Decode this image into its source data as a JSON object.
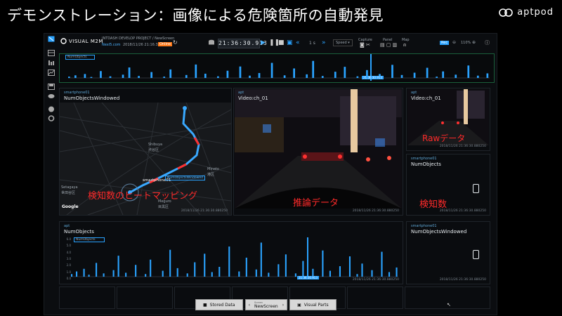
{
  "slide": {
    "title": "デモンストレーション：画像による危険箇所の自動発見",
    "logo_text": "aptpod"
  },
  "app": {
    "brand": "VISUAL M2M",
    "project": "INTDASH DEVELOP PROJECT / NewScreen",
    "edge": "Nexi5.com",
    "date": "2018/11/26 21:16:37 ~",
    "live_badge": "Online",
    "clock": "21:36:30.913",
    "rate": "1 s",
    "speed_label": "Speed",
    "capture_label": "Capture",
    "panel_label": "Panel",
    "map_label": "Map",
    "mode_badge": "Rec",
    "zoom": "110%",
    "timeline_legend": "NumObjects",
    "timeline_marker": "21:36:30.913"
  },
  "colors": {
    "accent": "#2aa3ff",
    "timeline_border": "#1a5e3a",
    "route": "#39a9ff",
    "route_hot": "#ff2f2f",
    "annotation": "#ff2a2a"
  },
  "panels": {
    "map": {
      "tag": "smartphone01",
      "title": "NumObjectsWindowed",
      "device_label": "smartphone01",
      "chip_label": "NumObjectsWindowed",
      "places": [
        "Shibuya",
        "渋谷区",
        "Minato",
        "港区",
        "Setagaya",
        "世田谷区",
        "Meguro",
        "目黒区"
      ],
      "google": "Google",
      "footer": "2018/11/26 21:36:30.880250",
      "annotation": "検知数のヒートマッピング"
    },
    "video1": {
      "tag": "apt",
      "title": "Video:ch_01",
      "footer": "2018/11/26 21:36:30.880250",
      "annotation": "推論データ"
    },
    "video2": {
      "tag": "apt",
      "title": "Video:ch_01",
      "footer": "2018/11/26 21:36:30.880250",
      "annotation": "Rawデータ"
    },
    "count1": {
      "tag": "smartphone01",
      "title": "NumObjects",
      "footer": "2018/11/26 21:36:30.880250",
      "annotation": "検知数"
    },
    "chart": {
      "tag": "apt",
      "title": "NumObjects",
      "legend": "NumObjects",
      "marker": "21:36:30.913",
      "footer": "2018/11/26 21:36:30.880250",
      "yticks": [
        "6.0",
        "5.0",
        "4.0",
        "3.0",
        "2.0",
        "1.0",
        "0.0"
      ]
    },
    "count2": {
      "tag": "smartphone01",
      "title": "NumObjectsWindowed",
      "footer": "2018/11/26 21:36:30.880250"
    }
  },
  "bottom": {
    "stored": "Stored Data",
    "screen_small": "Screen",
    "screen": "NewScreen",
    "visual": "Visual Parts"
  },
  "chart_data": {
    "type": "bar",
    "title": "NumObjects",
    "ylim": [
      0,
      6
    ],
    "yticks": [
      "6.0",
      "5.0",
      "4.0",
      "3.0",
      "2.0",
      "1.0",
      "0.0"
    ],
    "values": [
      0.4,
      0,
      0.8,
      0,
      0,
      1.2,
      0,
      0.3,
      0,
      0,
      2.1,
      0,
      0,
      0.5,
      0,
      0,
      0,
      1.0,
      0,
      3.2,
      0,
      0,
      0.6,
      0,
      0,
      0,
      1.8,
      0,
      0,
      0,
      0.4,
      0,
      2.6,
      0,
      0,
      0,
      0,
      0.9,
      0,
      0,
      4.1,
      0,
      0,
      1.3,
      0,
      0,
      0,
      0.5,
      0,
      0,
      2.2,
      0,
      0,
      0,
      3.5,
      0,
      0,
      0.7,
      0,
      0,
      1.5,
      0,
      0,
      0,
      4.6,
      0,
      0,
      0,
      0.8,
      0,
      0,
      2.9,
      0,
      0,
      0,
      1.1,
      0,
      5.2,
      0,
      0,
      0.6,
      0,
      0,
      0,
      1.9,
      0,
      0,
      3.4,
      0,
      0,
      0,
      0.5,
      0,
      0,
      2.4,
      0,
      0,
      0,
      1.2,
      0,
      0,
      0,
      4.0,
      0,
      0,
      0.9,
      0,
      0,
      0,
      1.6,
      0,
      0,
      0,
      3.1,
      0,
      0,
      0.4,
      0,
      2.0,
      0,
      0,
      0,
      1.0,
      0,
      0,
      0,
      3.8,
      0,
      0,
      0.7,
      0,
      0,
      1.4
    ]
  }
}
